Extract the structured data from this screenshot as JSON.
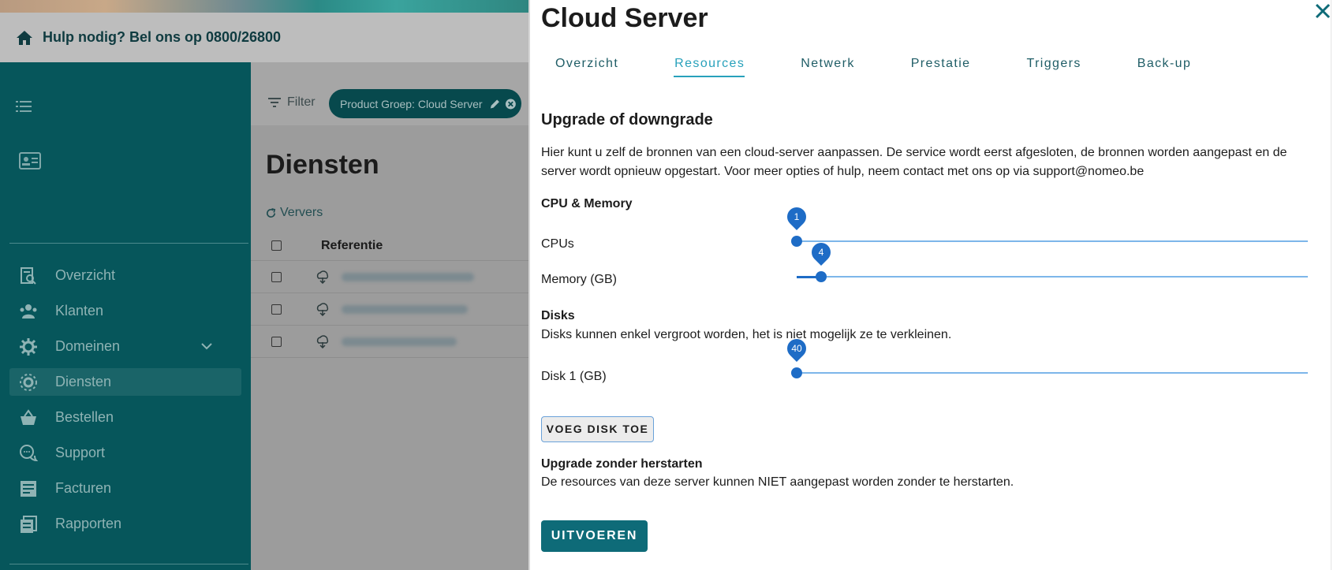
{
  "help_bar": {
    "text": "Hulp nodig? Bel ons op 0800/26800"
  },
  "sidebar": {
    "items": [
      {
        "label": "Overzicht"
      },
      {
        "label": "Klanten"
      },
      {
        "label": "Domeinen"
      },
      {
        "label": "Diensten"
      },
      {
        "label": "Bestellen"
      },
      {
        "label": "Support"
      },
      {
        "label": "Facturen"
      },
      {
        "label": "Rapporten"
      }
    ],
    "active": "Diensten"
  },
  "filter": {
    "label": "Filter",
    "chip": "Product Groep: Cloud Server"
  },
  "page": {
    "title": "Diensten",
    "refresh_label": "Ververs"
  },
  "table": {
    "columns": [
      "Referentie"
    ],
    "row_count": 3
  },
  "drawer": {
    "title": "Cloud Server",
    "tabs": [
      "Overzicht",
      "Resources",
      "Netwerk",
      "Prestatie",
      "Triggers",
      "Back-up"
    ],
    "active_tab": "Resources",
    "section_title": "Upgrade of downgrade",
    "description": "Hier kunt u zelf de bronnen van een cloud-server aanpassen. De service wordt eerst afgesloten, de bronnen worden aangepast en de server wordt opnieuw opgestart. Voor meer opties of hulp, neem contact met ons op via support@nomeo.be",
    "cpu_memory": {
      "title": "CPU & Memory",
      "cpus_label": "CPUs",
      "cpus_value": "1",
      "cpus_fraction": 0.0,
      "memory_label": "Memory (GB)",
      "memory_value": "4",
      "memory_fraction": 0.048
    },
    "disks": {
      "title": "Disks",
      "note": "Disks kunnen enkel vergroot worden, het is niet mogelijk ze te verkleinen.",
      "disk1_label": "Disk 1 (GB)",
      "disk1_value": "40",
      "disk1_fraction": 0.0
    },
    "add_disk_button": "VOEG DISK TOE",
    "no_restart": {
      "title": "Upgrade zonder herstarten",
      "text": "De resources van deze server kunnen NIET aangepast worden zonder te herstarten."
    },
    "execute_button": "UITVOEREN"
  },
  "colors": {
    "sidebar_bg": "#06565b",
    "accent": "#28a1bb",
    "slider": "#1e6cc6",
    "primary_button": "#0e6b78"
  }
}
